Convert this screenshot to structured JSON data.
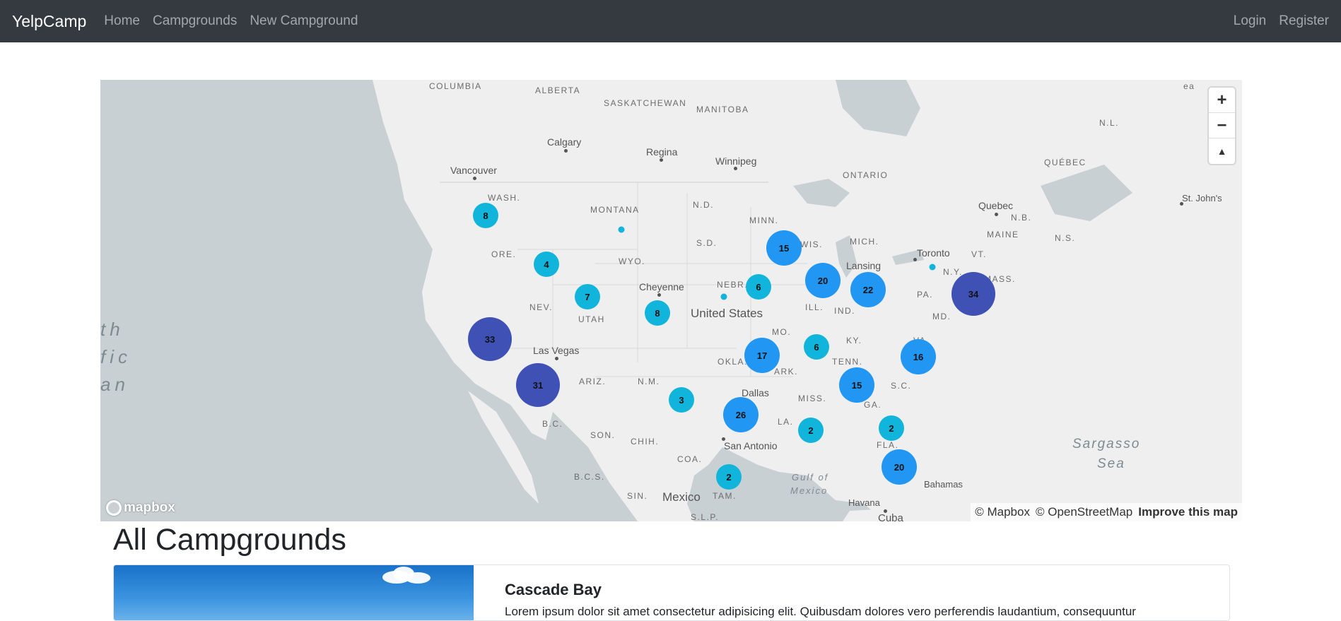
{
  "navbar": {
    "brand": "YelpCamp",
    "links": [
      "Home",
      "Campgrounds",
      "New Campground"
    ],
    "right_links": [
      "Login",
      "Register"
    ]
  },
  "map": {
    "labels": {
      "columbia": "COLUMBIA",
      "alberta": "ALBERTA",
      "saskatchewan": "SASKATCHEWAN",
      "manitoba": "MANITOBA",
      "ontario": "ONTARIO",
      "quebec_prov": "QUÉBEC",
      "nl": "N.L.",
      "calgary": "Calgary",
      "regina": "Regina",
      "winnipeg": "Winnipeg",
      "vancouver": "Vancouver",
      "quebec": "Quebec",
      "st_johns": "St. John's",
      "nb": "N.B.",
      "ns": "N.S.",
      "wash": "WASH.",
      "montana": "MONTANA",
      "nd": "N.D.",
      "minn": "MINN.",
      "maine": "MAINE",
      "vt": "VT.",
      "ore": "ORE.",
      "sd": "S.D.",
      "wis": "WIS.",
      "mich": "MICH.",
      "toronto": "Toronto",
      "wyo": "WYO.",
      "cheyenne": "Cheyenne",
      "nebr": "NEBR.",
      "lansing": "Lansing",
      "ny": "N.Y.",
      "mass": "MASS.",
      "pa": "PA.",
      "nev": "NEV.",
      "utah": "UTAH",
      "united_states": "United States",
      "ill": "ILL.",
      "ind": "IND.",
      "md": "MD.",
      "mo": "MO.",
      "ky": "KY.",
      "va": "VA.",
      "las_vegas": "Las Vegas",
      "okla": "OKLA.",
      "ark": "ARK.",
      "tenn": "TENN.",
      "ariz": "ARIZ.",
      "nm": "N.M.",
      "dallas": "Dallas",
      "sc": "S.C.",
      "miss": "MISS.",
      "ga": "GA.",
      "la": "LA.",
      "bc": "B.C.",
      "son": "SON.",
      "chih": "CHIH.",
      "san_antonio": "San Antonio",
      "fla": "FLA.",
      "coa": "COA.",
      "bcs": "B.C.S.",
      "gulf": "Gulf of",
      "gulf2": "Mexico",
      "sargasso": "Sargasso",
      "sea": "Sea",
      "bahamas": "Bahamas",
      "sin": "SIN.",
      "mexico": "Mexico",
      "tam": "TAM.",
      "slp": "S.L.P.",
      "havana": "Havana",
      "cuba": "Cuba",
      "pac1": "th",
      "pac2": "fic",
      "pac3": "an",
      "tr_edge": "ea"
    },
    "clusters": [
      {
        "count": "8",
        "size": "s"
      },
      {
        "count": "4",
        "size": "s"
      },
      {
        "count": "7",
        "size": "s"
      },
      {
        "count": "8",
        "size": "s"
      },
      {
        "count": "33",
        "size": "l"
      },
      {
        "count": "31",
        "size": "l"
      },
      {
        "count": "3",
        "size": "s"
      },
      {
        "count": "15",
        "size": "m"
      },
      {
        "count": "6",
        "size": "s"
      },
      {
        "count": "20",
        "size": "m"
      },
      {
        "count": "22",
        "size": "m"
      },
      {
        "count": "34",
        "size": "l"
      },
      {
        "count": "17",
        "size": "m"
      },
      {
        "count": "6",
        "size": "s"
      },
      {
        "count": "16",
        "size": "m"
      },
      {
        "count": "15",
        "size": "m"
      },
      {
        "count": "26",
        "size": "m"
      },
      {
        "count": "2",
        "size": "s"
      },
      {
        "count": "2",
        "size": "s"
      },
      {
        "count": "2",
        "size": "s"
      },
      {
        "count": "20",
        "size": "m"
      }
    ],
    "controls": {
      "zoom_in": "+",
      "zoom_out": "−",
      "compass": "▲"
    },
    "logo": "mapbox",
    "attribution": {
      "mapbox": "© Mapbox",
      "osm": "© OpenStreetMap",
      "improve": "Improve this map"
    }
  },
  "page": {
    "heading": "All Campgrounds"
  },
  "campground": {
    "title": "Cascade Bay",
    "description": "Lorem ipsum dolor sit amet consectetur adipisicing elit. Quibusdam dolores vero perferendis laudantium, consequuntur"
  }
}
